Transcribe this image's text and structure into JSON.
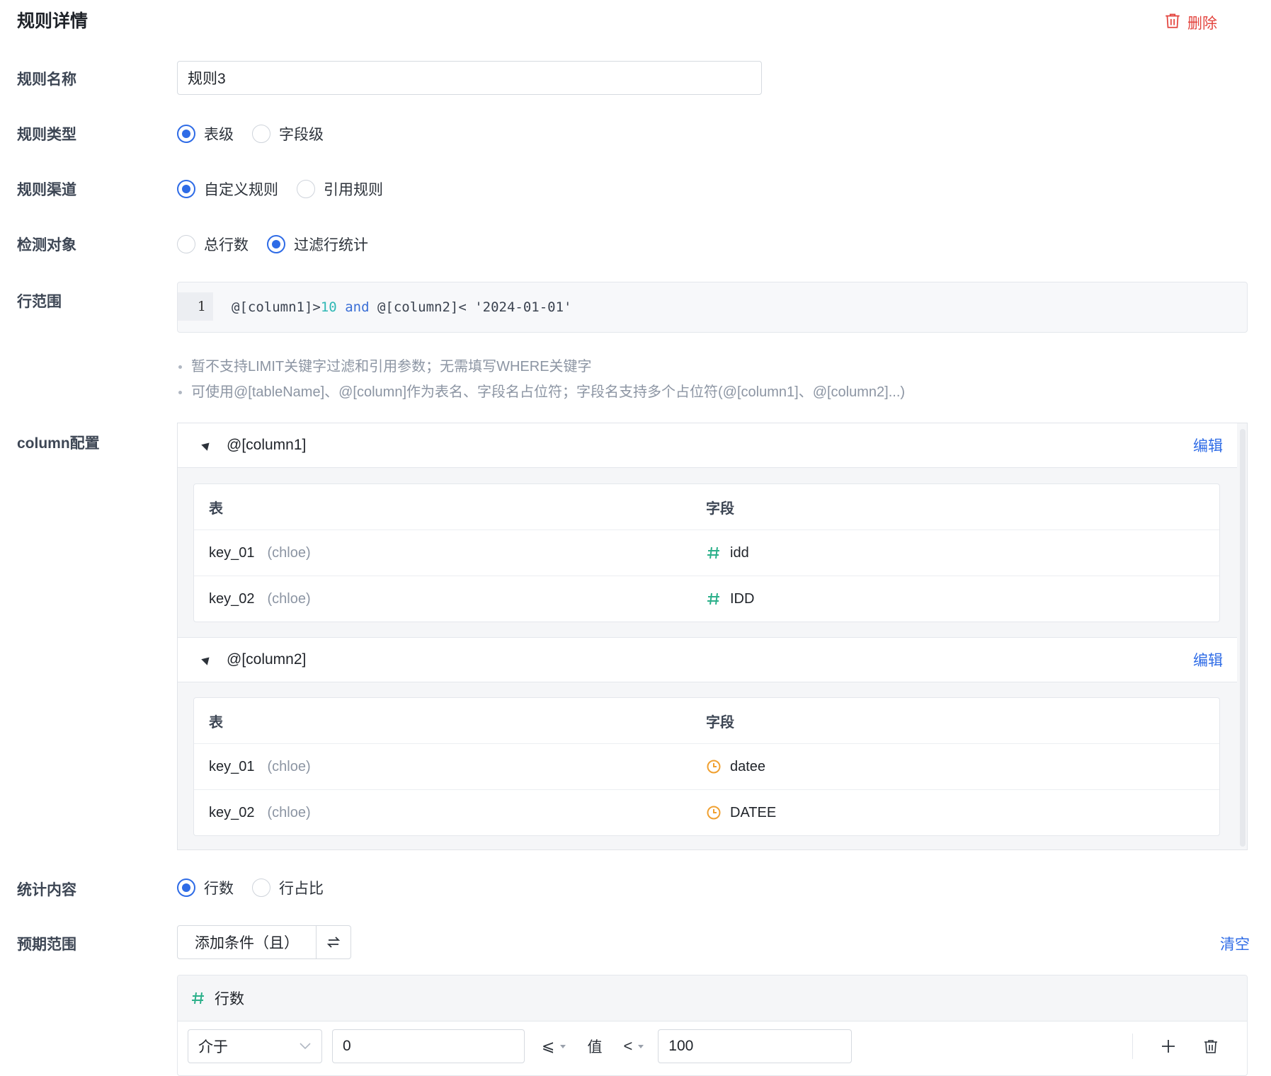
{
  "header": {
    "title": "规则详情",
    "delete_label": "删除"
  },
  "form": {
    "name_label": "规则名称",
    "name_value": "规则3",
    "type_label": "规则类型",
    "type_options": [
      "表级",
      "字段级"
    ],
    "channel_label": "规则渠道",
    "channel_options": [
      "自定义规则",
      "引用规则"
    ],
    "target_label": "检测对象",
    "target_options": [
      "总行数",
      "过滤行统计"
    ],
    "range_label": "行范围",
    "code": {
      "line_number": "1",
      "parts": [
        "@[column1]>",
        "10",
        " ",
        "and",
        " @[column2]< '2024-01-01'"
      ]
    },
    "tips": [
      "暂不支持LIMIT关键字过滤和引用参数；无需填写WHERE关键字",
      "可使用@[tableName]、@[column]作为表名、字段名占位符；字段名支持多个占位符(@[column1]、@[column2]...)"
    ],
    "column_label": "column配置",
    "columns": [
      {
        "name": "@[column1]",
        "edit_label": "编辑",
        "header": [
          "表",
          "字段"
        ],
        "rows": [
          {
            "table": "key_01",
            "owner": "(chloe)",
            "field": "idd",
            "field_type": "number-icon"
          },
          {
            "table": "key_02",
            "owner": "(chloe)",
            "field": "IDD",
            "field_type": "number-icon"
          }
        ]
      },
      {
        "name": "@[column2]",
        "edit_label": "编辑",
        "header": [
          "表",
          "字段"
        ],
        "rows": [
          {
            "table": "key_01",
            "owner": "(chloe)",
            "field": "datee",
            "field_type": "clock-icon"
          },
          {
            "table": "key_02",
            "owner": "(chloe)",
            "field": "DATEE",
            "field_type": "clock-icon"
          }
        ]
      }
    ],
    "stat_label": "统计内容",
    "stat_options": [
      "行数",
      "行占比"
    ],
    "expect_label": "预期范围",
    "add_condition_label": "添加条件（且）",
    "clear_label": "清空",
    "condition": {
      "metric": "行数",
      "operator": "介于",
      "min_value": "0",
      "lower_op": "⩽",
      "value_label": "值",
      "upper_op": "<",
      "max_value": "100"
    }
  },
  "colors": {
    "primary": "#2e6be6",
    "danger": "#e3433d",
    "number_icon": "#2bb08a",
    "clock_icon": "#f0a030"
  }
}
